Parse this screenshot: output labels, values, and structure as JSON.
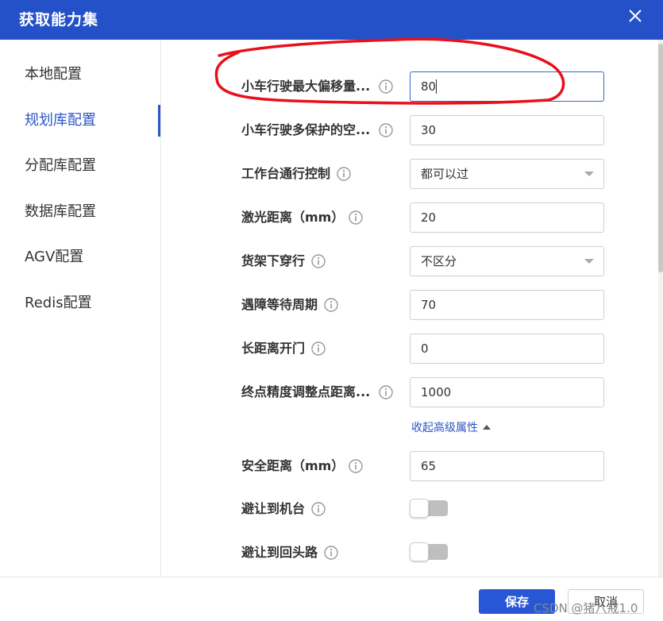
{
  "dialog": {
    "title": "获取能力集"
  },
  "sidebar": {
    "items": [
      {
        "label": "本地配置"
      },
      {
        "label": "规划库配置"
      },
      {
        "label": "分配库配置"
      },
      {
        "label": "数据库配置"
      },
      {
        "label": "AGV配置"
      },
      {
        "label": "Redis配置"
      }
    ],
    "active_index": 1
  },
  "form": {
    "fields": [
      {
        "label": "小车行驶最大偏移量...",
        "value": "80"
      },
      {
        "label": "小车行驶多保护的空...",
        "value": "30"
      },
      {
        "label": "工作台通行控制",
        "value": "都可以过"
      },
      {
        "label": "激光距离（mm）",
        "value": "20"
      },
      {
        "label": "货架下穿行",
        "value": "不区分"
      },
      {
        "label": "遇障等待周期",
        "value": "70"
      },
      {
        "label": "长距离开门",
        "value": "0"
      },
      {
        "label": "终点精度调整点距离...",
        "value": "1000"
      }
    ],
    "collapse_label": "收起高级属性",
    "advanced": [
      {
        "label": "安全距离（mm）",
        "value": "65"
      },
      {
        "label": "避让到机台",
        "toggle_on": false
      },
      {
        "label": "避让到回头路",
        "toggle_on": false
      }
    ]
  },
  "footer": {
    "save_label": "保存",
    "cancel_label": "取消",
    "watermark": "CSDN @猪八戒1.0"
  },
  "colors": {
    "primary": "#2451c8",
    "annotation_red": "#e8101a"
  }
}
